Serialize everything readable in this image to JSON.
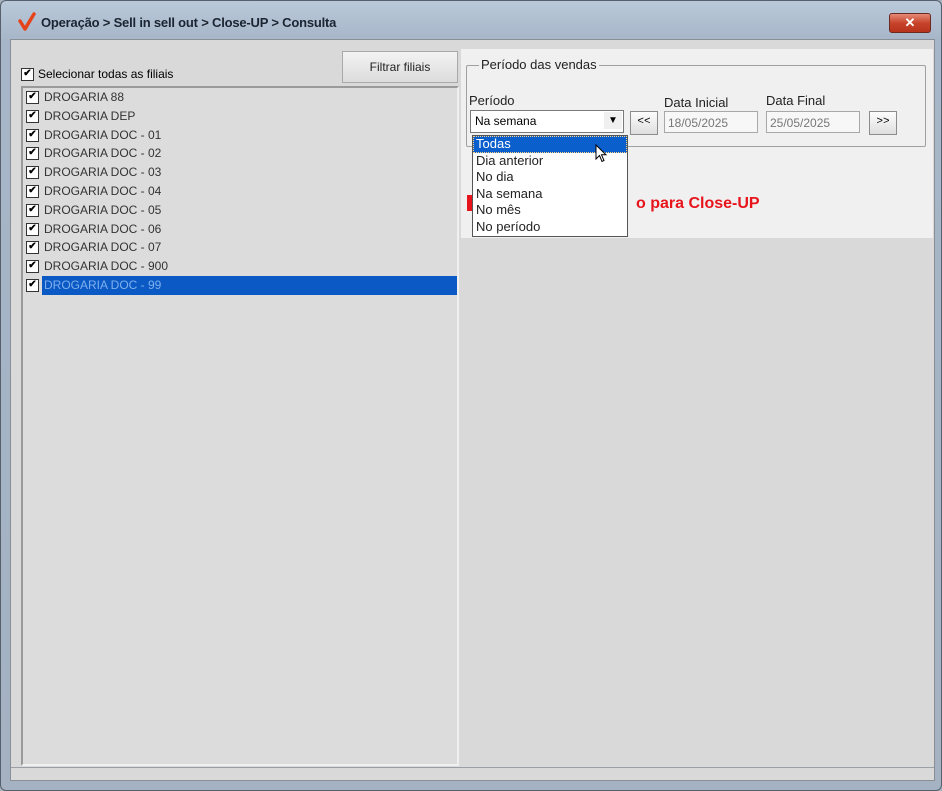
{
  "window": {
    "title": "Operação > Sell in sell out > Close-UP > Consulta",
    "close_label": "✕"
  },
  "filiais": {
    "select_all_label": "Selecionar todas as filiais",
    "select_all_checked": true,
    "filter_button_label": "Filtrar filiais",
    "items": [
      {
        "label": "DROGARIA 88",
        "checked": true,
        "selected": false
      },
      {
        "label": "DROGARIA DEP",
        "checked": true,
        "selected": false
      },
      {
        "label": "DROGARIA DOC - 01",
        "checked": true,
        "selected": false
      },
      {
        "label": "DROGARIA DOC - 02",
        "checked": true,
        "selected": false
      },
      {
        "label": "DROGARIA DOC - 03",
        "checked": true,
        "selected": false
      },
      {
        "label": "DROGARIA DOC - 04",
        "checked": true,
        "selected": false
      },
      {
        "label": "DROGARIA DOC - 05",
        "checked": true,
        "selected": false
      },
      {
        "label": "DROGARIA DOC - 06",
        "checked": true,
        "selected": false
      },
      {
        "label": "DROGARIA DOC - 07",
        "checked": true,
        "selected": false
      },
      {
        "label": "DROGARIA DOC - 900",
        "checked": true,
        "selected": false
      },
      {
        "label": "DROGARIA DOC - 99",
        "checked": true,
        "selected": true
      }
    ]
  },
  "periodo": {
    "group_title": "Período das vendas",
    "periodo_label": "Período",
    "periodo_value": "Na semana",
    "prev_label": "<<",
    "next_label": ">>",
    "data_inicial_label": "Data Inicial",
    "data_inicial_value": "18/05/2025",
    "data_final_label": "Data Final",
    "data_final_value": "25/05/2025",
    "message": "o para Close-UP",
    "dropdown_options": [
      "Todas",
      "Dia anterior",
      "No dia",
      "Na semana",
      "No mês",
      "No período"
    ],
    "dropdown_highlighted": "Todas"
  },
  "colors": {
    "selection": "#0a59c4",
    "message_red": "#e8141c"
  }
}
